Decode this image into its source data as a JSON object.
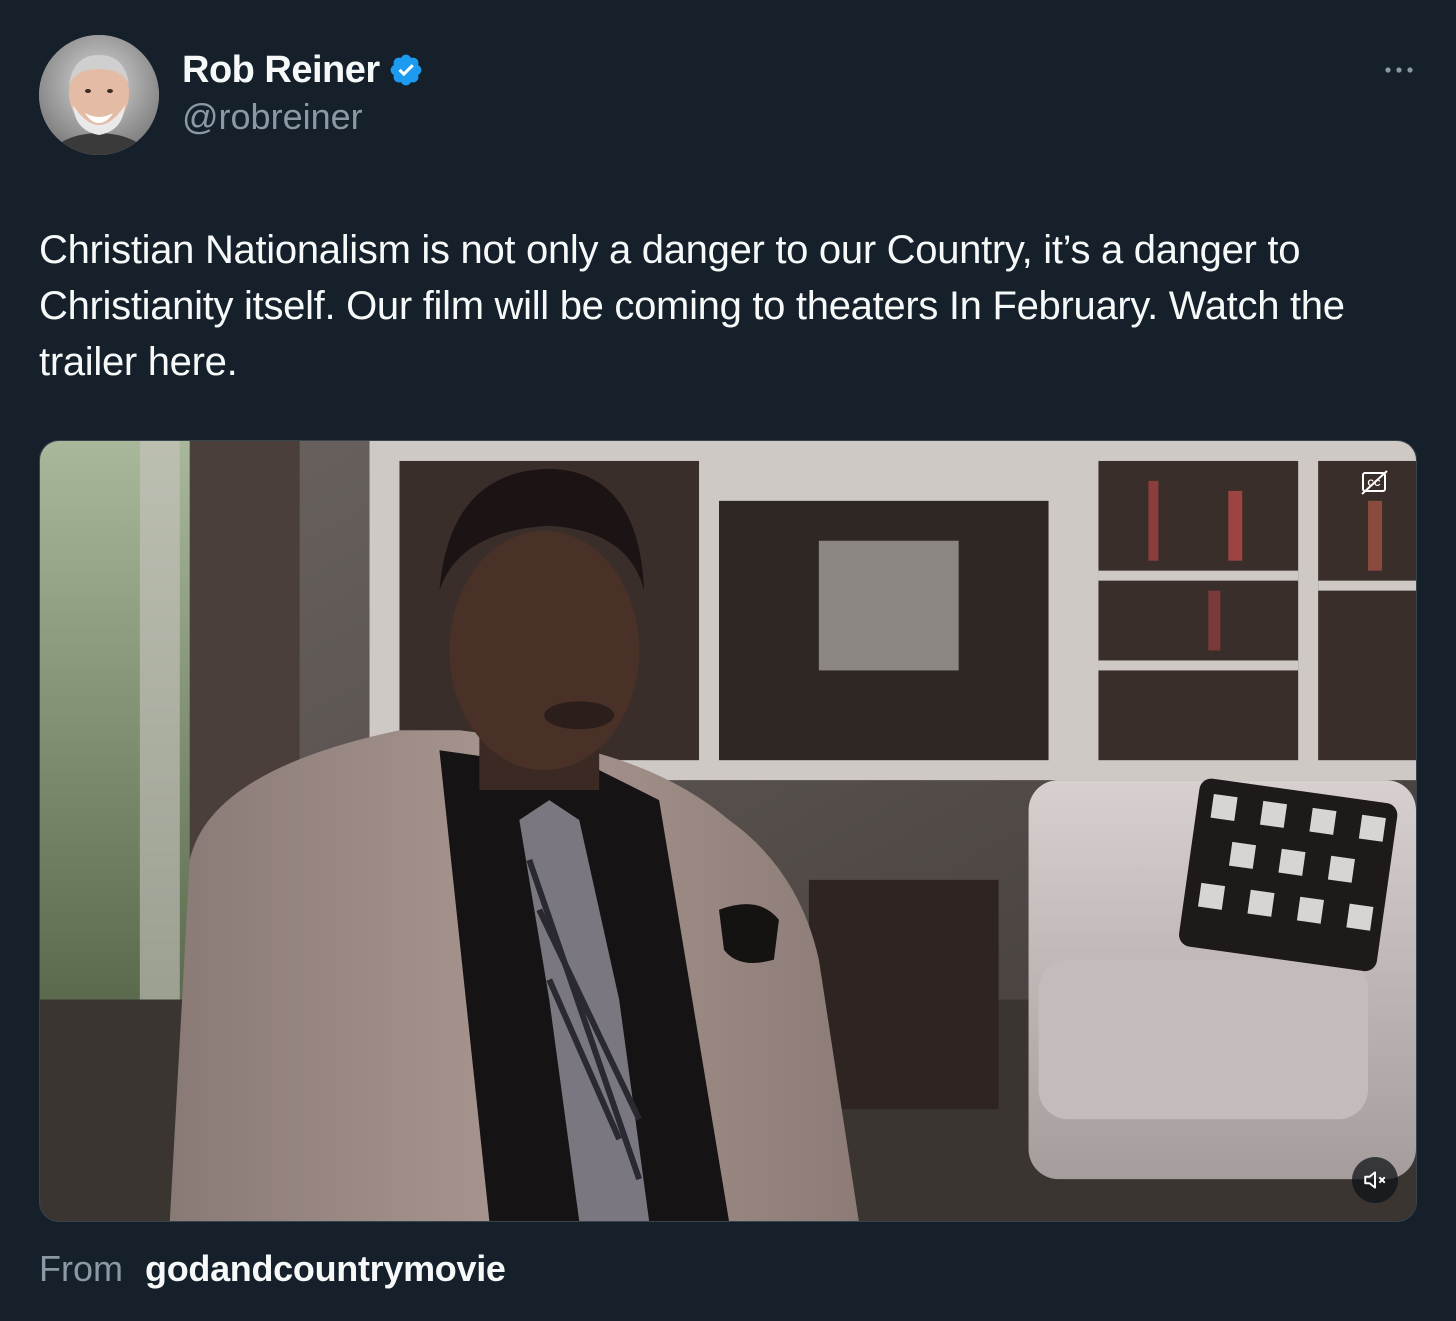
{
  "author": {
    "display_name": "Rob Reiner",
    "handle": "@robreiner",
    "verified": true,
    "avatar_icon": "profile-photo"
  },
  "menu": {
    "icon": "more-horizontal-icon"
  },
  "tweet": {
    "text": "Christian Nationalism is not only a danger to our Country, it’s a danger to Christianity itself. Our film will be coming to theaters In February. Watch the trailer here."
  },
  "media": {
    "type": "video",
    "captions_icon": "captions-off-icon",
    "mute_icon": "volume-muted-icon"
  },
  "source": {
    "label": "From",
    "name": "godandcountrymovie"
  },
  "colors": {
    "background": "#15202b",
    "text": "#f7f9f9",
    "secondary_text": "#8b98a5",
    "verified_blue": "#1d9bf0"
  }
}
